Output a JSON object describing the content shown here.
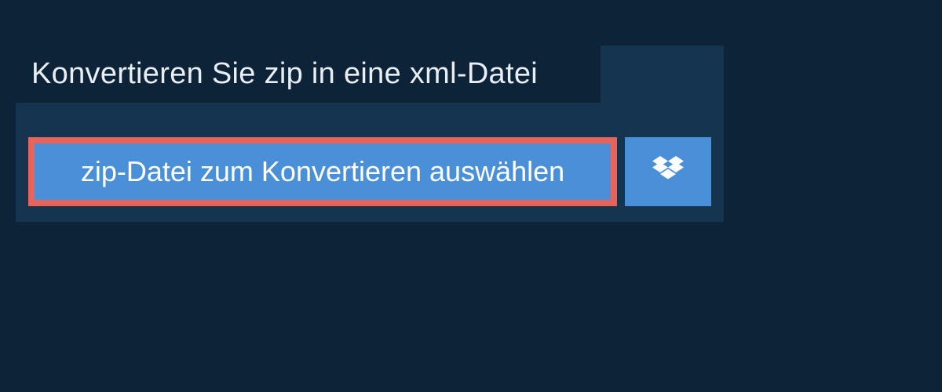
{
  "title": "Konvertieren Sie zip in eine xml-Datei",
  "buttons": {
    "select_file_label": "zip-Datei zum Konvertieren auswählen"
  },
  "colors": {
    "background": "#0d2438",
    "panel": "#153450",
    "button_bg": "#4a90d9",
    "button_border": "#e8645a",
    "text_light": "#e8eef3",
    "text_white": "#ffffff"
  }
}
